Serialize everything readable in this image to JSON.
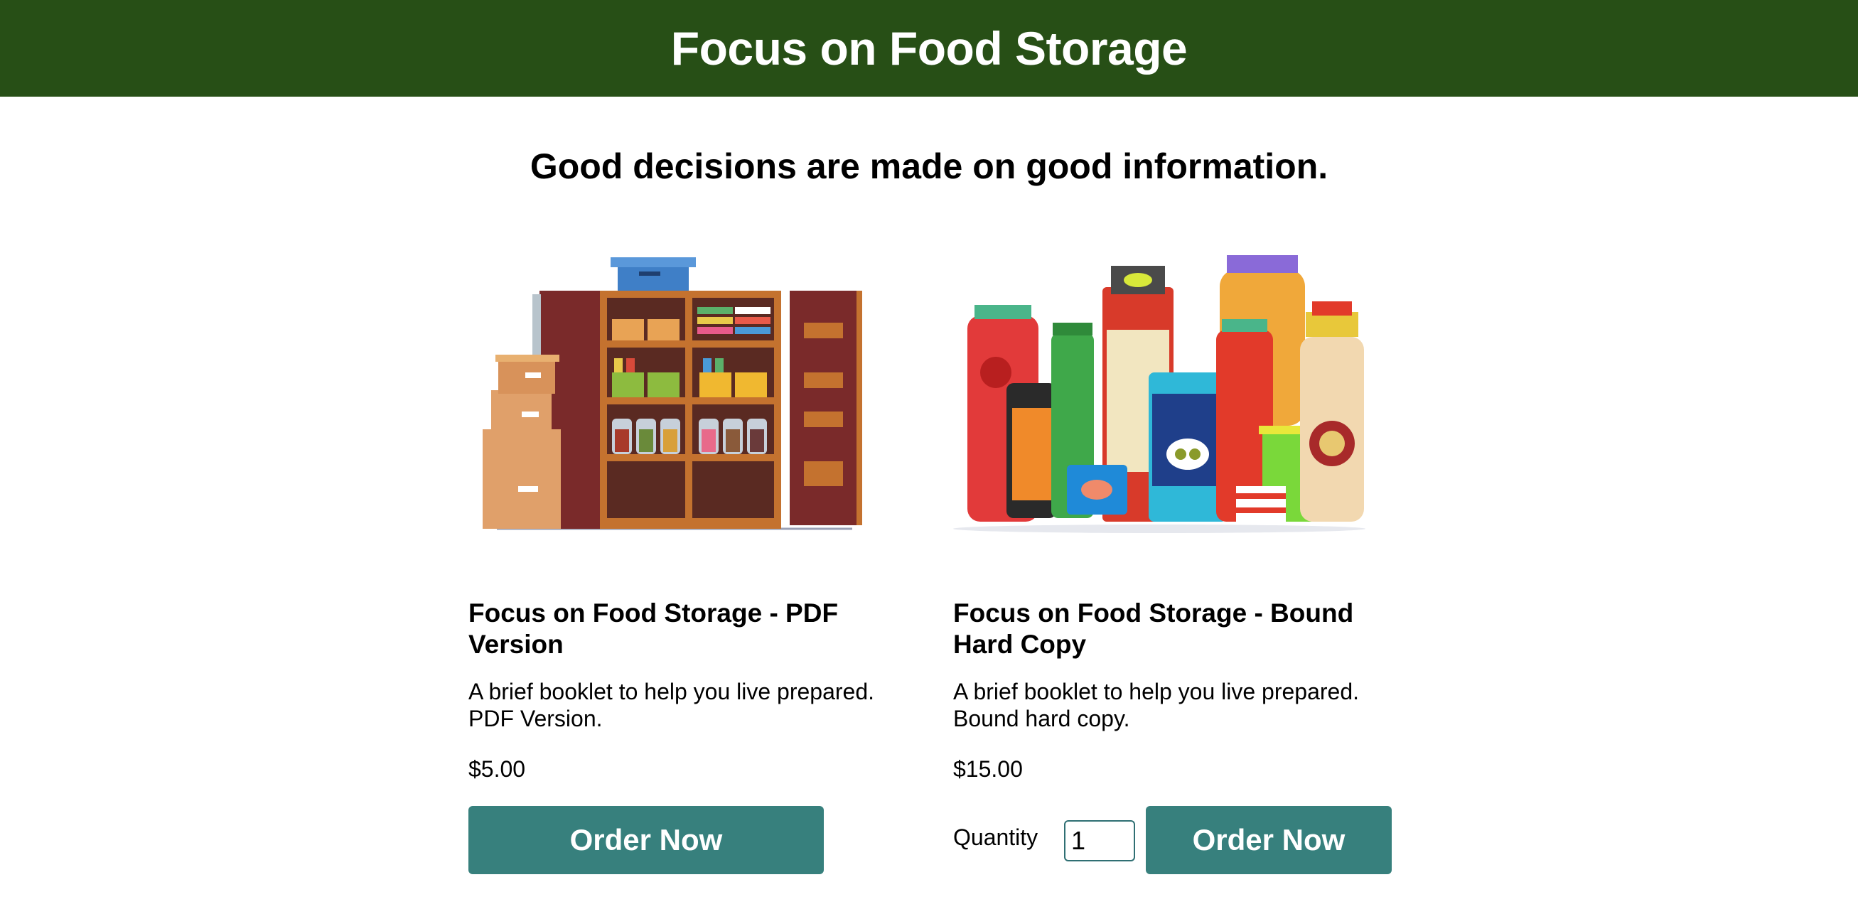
{
  "header": {
    "title": "Focus on Food Storage"
  },
  "tagline": "Good decisions are made on good information.",
  "products": [
    {
      "title": "Focus on Food Storage - PDF Version",
      "description": "A brief booklet to help you live prepared. PDF Version.",
      "price": "$5.00",
      "button": "Order Now",
      "image": "pantry-cabinet-illustration"
    },
    {
      "title": "Focus on Food Storage - Bound Hard Copy",
      "description": "A brief booklet to help you live prepared. Bound hard copy.",
      "price": "$15.00",
      "quantity_label": "Quantity",
      "quantity_value": "1",
      "button": "Order Now",
      "image": "canned-goods-jars-illustration"
    }
  ],
  "colors": {
    "header_bg": "#274f16",
    "button_bg": "#37807d"
  }
}
